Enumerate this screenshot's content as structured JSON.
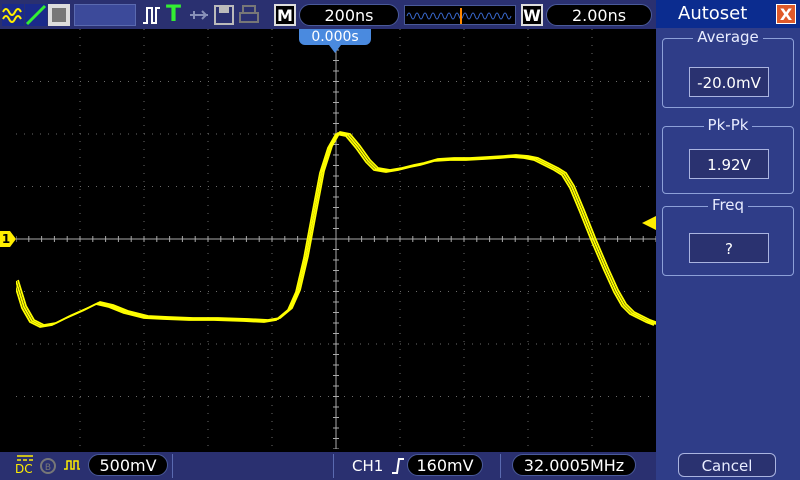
{
  "topbar": {
    "timebase": "200ns",
    "window_scale": "2.00ns",
    "m_label": "M",
    "w_label": "W",
    "trigger_time": "0.000s"
  },
  "bottombar": {
    "coupling": "DC",
    "ch_scale": "500mV",
    "trigger_channel": "CH1",
    "trigger_level": "160mV",
    "frequency": "32.0005MHz"
  },
  "channel_marker": "1",
  "panel": {
    "title": "Autoset",
    "close_label": "X",
    "average_label": "Average",
    "average_value": "-20.0mV",
    "pkpk_label": "Pk-Pk",
    "pkpk_value": "1.92V",
    "freq_label": "Freq",
    "freq_value": "?",
    "cancel_label": "Cancel"
  },
  "colors": {
    "trace": "#ffff00",
    "grid": "#6a6a6a",
    "accent": "#4a8adf"
  }
}
